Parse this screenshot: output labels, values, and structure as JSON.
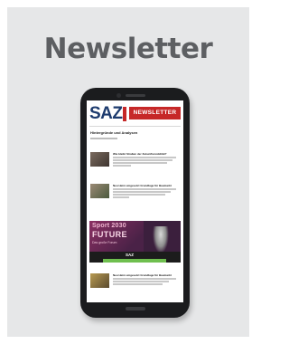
{
  "card": {
    "title": "Newsletter"
  },
  "newsletter": {
    "logo": "SAZ",
    "banner": "NEWSLETTER",
    "section_heading": "Hintergründe und Analysen",
    "articles": [
      {
        "title": "Wie bleibt Straßen der Zukunftsmobilität?"
      },
      {
        "title": "Neu Heim umgesetzt Grundlage für Baumarkt"
      },
      {
        "title": "Neu Heim umgesetzt Grundlage für Baumarkt"
      }
    ],
    "ad": {
      "line1": "Sport 2030",
      "line2": "FUTURE",
      "line3": "Das große Forum",
      "brand": "SAZ"
    }
  },
  "colors": {
    "card_bg": "#e6e7e8",
    "title": "#5d5f62",
    "brand_red": "#c62828",
    "brand_blue": "#1d3b6e"
  }
}
